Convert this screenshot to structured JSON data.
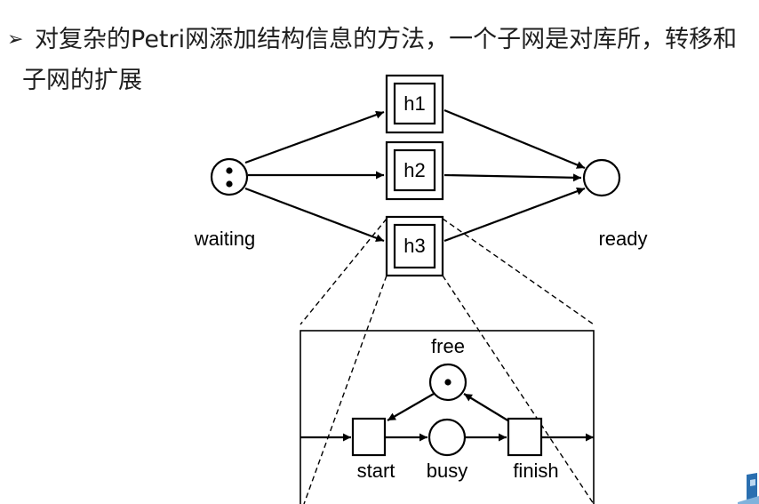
{
  "slide": {
    "bullet_marker": "➢",
    "text": "对复杂的Petri网添加结构信息的方法，一个子网是对库所，转移和子网的扩展"
  },
  "diagram": {
    "top_places": {
      "waiting": "waiting",
      "ready": "ready"
    },
    "transitions": {
      "h1": "h1",
      "h2": "h2",
      "h3": "h3"
    },
    "subnet": {
      "free": "free",
      "start": "start",
      "busy": "busy",
      "finish": "finish"
    }
  },
  "logo_icon": "corner-logo-icon"
}
